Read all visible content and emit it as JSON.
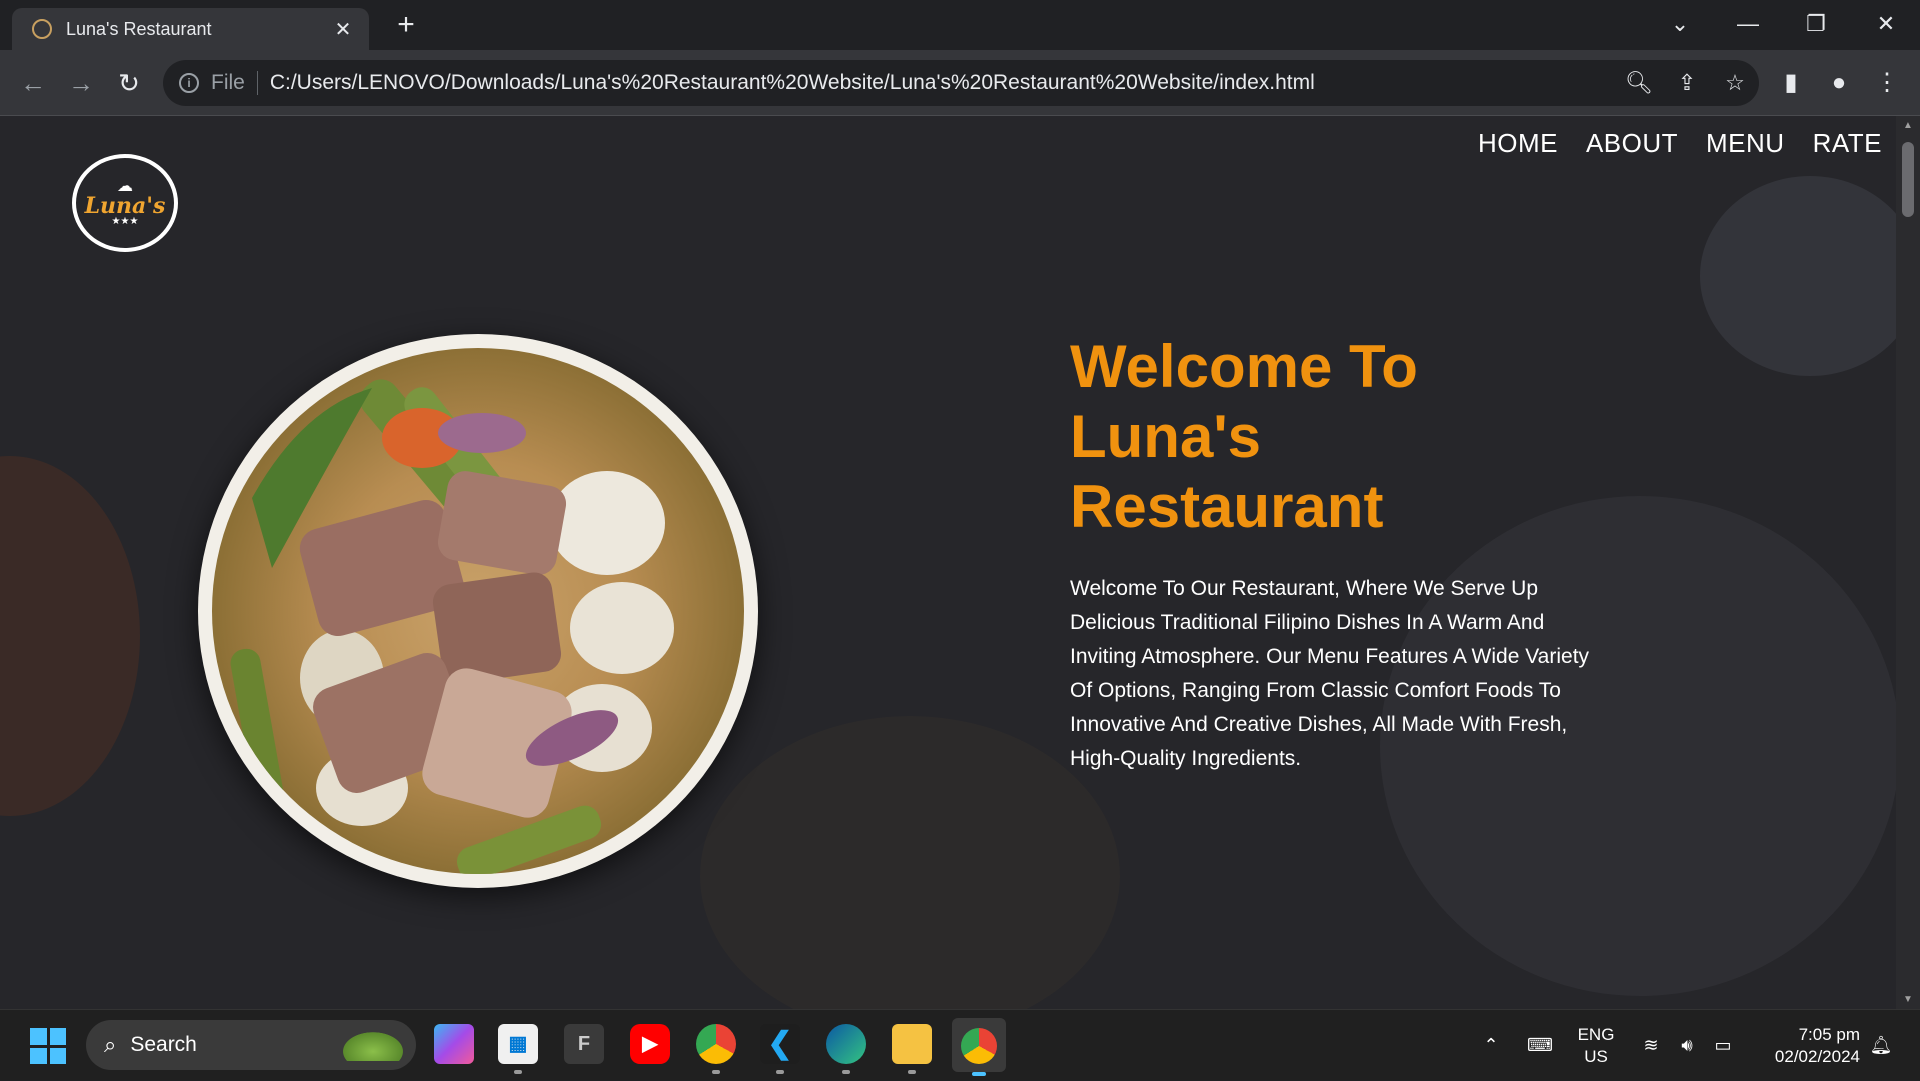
{
  "browser": {
    "tab_title": "Luna's Restaurant",
    "tab_close": "✕",
    "new_tab": "+",
    "scheme": "File",
    "url": "C:/Users/LENOVO/Downloads/Luna's%20Restaurant%20Website/Luna's%20Restaurant%20Website/index.html"
  },
  "site": {
    "logo_text": "Luna's",
    "nav": [
      "HOME",
      "ABOUT",
      "MENU",
      "RATE"
    ],
    "hero_title": "Welcome To Luna's Restaurant",
    "hero_text": "Welcome To Our Restaurant, Where We Serve Up Delicious Traditional Filipino Dishes In A Warm And Inviting Atmosphere. Our Menu Features A Wide Variety Of Options, Ranging From Classic Comfort Foods To Innovative And Creative Dishes, All Made With Fresh, High-Quality Ingredients."
  },
  "taskbar": {
    "search_label": "Search",
    "lang_1": "ENG",
    "lang_2": "US",
    "time": "7:05 pm",
    "date": "02/02/2024"
  },
  "colors": {
    "accent": "#f0920f",
    "page_bg": "#26262a",
    "chrome_bg": "#35363a"
  }
}
